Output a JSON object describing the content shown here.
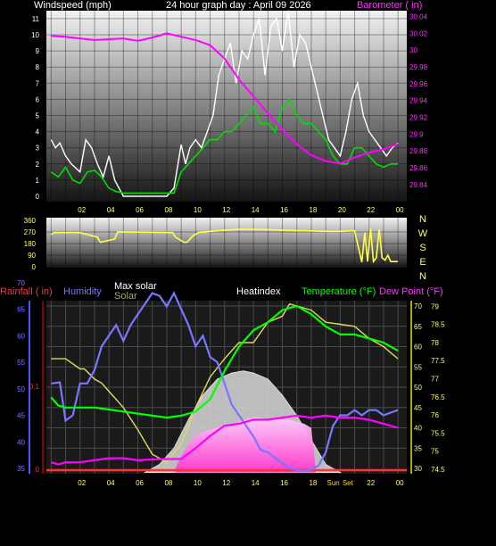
{
  "title": "24 hour graph day : April 09 2026",
  "colors": {
    "wind": "#ffffff",
    "gust": "#00dd00",
    "baro": "#ff00ff",
    "dir": "#ffff44",
    "rain": "#ff3333",
    "humidity": "#7777ff",
    "solar": "#dddddd",
    "solar_fill": "#ff66ff",
    "temp": "#00ff00",
    "dew": "#ff00ff",
    "heatindex": "#dddd55",
    "yaxis": "#ffff66"
  },
  "chart_data": [
    {
      "type": "line",
      "ylabel": "Windspeed (mph)",
      "y2label": "Barometer ( in)",
      "x_ticks": [
        "02",
        "04",
        "06",
        "08",
        "10",
        "12",
        "14",
        "16",
        "18",
        "20",
        "22",
        "00"
      ],
      "y_ticks": [
        "0",
        "1",
        "2",
        "3",
        "4",
        "5",
        "6",
        "7",
        "8",
        "9",
        "10",
        "11"
      ],
      "y2_ticks": [
        "29.84",
        "29.86",
        "29.88",
        "29.9",
        "29.92",
        "29.94",
        "29.96",
        "29.98",
        "30",
        "30.02",
        "30.04"
      ],
      "ylim": [
        0,
        11.7
      ],
      "y2lim": [
        29.826,
        30.047
      ],
      "series": [
        {
          "key": "wind_max",
          "hours": [
            0,
            0.3,
            0.6,
            1,
            1.4,
            2,
            2.4,
            2.8,
            3.2,
            3.6,
            4,
            4.4,
            5,
            5.5,
            6,
            6.5,
            7,
            7.5,
            8,
            8.5,
            9,
            9.3,
            9.6,
            10,
            10.4,
            10.8,
            11.2,
            11.6,
            12,
            12.4,
            12.8,
            13.2,
            13.6,
            14,
            14.4,
            14.8,
            15.2,
            15.6,
            16,
            16.4,
            16.8,
            17.2,
            17.6,
            18,
            18.4,
            18.8,
            19.2,
            19.6,
            20,
            20.4,
            20.8,
            21.2,
            21.6,
            22,
            22.4,
            22.8,
            23.2,
            23.6,
            24
          ],
          "values": [
            3.5,
            3,
            3.3,
            2.5,
            2,
            1.5,
            3.5,
            3,
            2,
            1.2,
            2.5,
            1,
            0,
            0,
            0,
            0,
            0,
            0,
            0,
            0.5,
            3.2,
            2,
            3,
            3.5,
            3,
            4,
            5,
            7.5,
            8.5,
            9.5,
            7,
            9,
            8.5,
            10,
            11,
            7.5,
            10.5,
            11,
            9,
            11.5,
            8,
            10,
            9.5,
            8,
            6.5,
            5,
            3.5,
            3,
            2.5,
            4,
            6,
            7,
            5,
            4,
            3.5,
            3,
            2.5,
            3,
            3.3
          ]
        },
        {
          "key": "wind_avg",
          "hours": [
            0,
            0.5,
            1,
            1.5,
            2,
            2.5,
            3,
            3.5,
            4,
            4.5,
            5,
            5.5,
            6,
            6.5,
            7,
            7.5,
            8,
            8.5,
            9,
            9.5,
            10,
            10.5,
            11,
            11.5,
            12,
            12.5,
            13,
            13.5,
            14,
            14.5,
            15,
            15.5,
            16,
            16.5,
            17,
            17.5,
            18,
            18.5,
            19,
            19.5,
            20,
            20.5,
            21,
            21.5,
            22,
            22.5,
            23,
            23.5,
            24
          ],
          "values": [
            1.5,
            1.2,
            1.8,
            1,
            0.8,
            1.5,
            1.6,
            1.2,
            0.5,
            0.3,
            0.2,
            0.2,
            0.2,
            0.2,
            0.2,
            0.2,
            0.2,
            0.2,
            1.5,
            2,
            2.5,
            3,
            3.5,
            3.5,
            4,
            4,
            4.5,
            5,
            5.5,
            4.5,
            4.5,
            4,
            5.5,
            6,
            5,
            4.5,
            4.5,
            4,
            3.5,
            2.5,
            2,
            2,
            3,
            3,
            2.5,
            2,
            1.8,
            2,
            2
          ]
        },
        {
          "key": "barometer",
          "hours": [
            0,
            1,
            2,
            3,
            4,
            5,
            6,
            7,
            8,
            9,
            10,
            11,
            12,
            13,
            14,
            15,
            16,
            17,
            18,
            19,
            20,
            21,
            22,
            23,
            24
          ],
          "values": [
            30.017,
            30.016,
            30.014,
            30.012,
            30.013,
            30.014,
            30.011,
            30.015,
            30.02,
            30.016,
            30.012,
            30.006,
            29.99,
            29.965,
            29.945,
            29.925,
            29.905,
            29.888,
            29.875,
            29.868,
            29.865,
            29.872,
            29.878,
            29.882,
            29.888
          ]
        }
      ]
    },
    {
      "type": "line",
      "ylabel": "Wind direction (deg)",
      "y_ticks": [
        "0",
        "90",
        "180",
        "270",
        "360"
      ],
      "compass": [
        "N",
        "W",
        "S",
        "E",
        "N"
      ],
      "ylim": [
        0,
        360
      ],
      "series": [
        {
          "key": "direction",
          "hours": [
            0,
            0.2,
            2,
            3.2,
            3.4,
            4.4,
            4.6,
            8.4,
            8.6,
            9.2,
            9.4,
            9.8,
            10.2,
            11,
            12,
            13,
            14,
            15,
            16,
            17,
            18,
            19,
            20,
            21,
            21.5,
            21.7,
            21.9,
            22.1,
            22.3,
            22.5,
            22.7,
            22.9,
            23.1,
            23.3,
            23.5,
            23.8,
            24
          ],
          "values": [
            250,
            265,
            265,
            230,
            190,
            215,
            270,
            265,
            230,
            190,
            190,
            240,
            265,
            275,
            283,
            290,
            290,
            288,
            283,
            280,
            278,
            275,
            275,
            280,
            35,
            265,
            40,
            300,
            40,
            70,
            290,
            70,
            50,
            90,
            40,
            40,
            40
          ]
        }
      ]
    },
    {
      "type": "line",
      "legend": [
        "Rainfall ( in)",
        "Humidity",
        "Max solar",
        "Solar",
        "Heatindex",
        "Temperature (°F)",
        "Dew Point (°F)"
      ],
      "x_ticks": [
        "02",
        "04",
        "06",
        "08",
        "10",
        "12",
        "14",
        "16",
        "18",
        "Sun",
        "Set",
        "22",
        "00"
      ],
      "humidity_ticks": [
        "35",
        "40",
        "45",
        "50",
        "55",
        "60",
        "65",
        "70"
      ],
      "rain_ticks": [
        "0",
        "0.1"
      ],
      "temp_ticks": [
        "30",
        "35",
        "40",
        "45",
        "50",
        "55",
        "60",
        "65",
        "70"
      ],
      "right_ticks": [
        "74.5",
        "75",
        "75.5",
        "76",
        "76.5",
        "77",
        "77.5",
        "78",
        "78.5",
        "79"
      ],
      "humidity_lim": [
        32,
        71.2
      ],
      "temp_lim": [
        28.9,
        71.8
      ],
      "series": [
        {
          "key": "humidity",
          "hours": [
            0,
            0.6,
            1,
            1.5,
            2,
            2.5,
            3,
            3.5,
            4,
            4.5,
            5,
            5.5,
            6,
            6.5,
            7,
            7.5,
            8,
            8.5,
            9,
            9.5,
            10,
            10.5,
            11,
            11.5,
            12,
            12.5,
            13,
            13.5,
            14,
            14.5,
            15,
            15.5,
            16,
            16.5,
            17,
            17.5,
            18,
            18.5,
            19,
            19.5,
            20,
            20.5,
            21,
            21.5,
            22,
            22.5,
            23,
            23.5,
            24
          ],
          "values": [
            51,
            51.2,
            44,
            45,
            51,
            51,
            53.5,
            58,
            60,
            62,
            59,
            62,
            64,
            66,
            68,
            67.5,
            65.5,
            68,
            65,
            62,
            58,
            60,
            56,
            55,
            51,
            47,
            45,
            43,
            41,
            38.5,
            38,
            37,
            36,
            35,
            34.7,
            34.5,
            34.8,
            35.5,
            38,
            43,
            45,
            45,
            46,
            45,
            46,
            46,
            45,
            45.5,
            46
          ]
        },
        {
          "key": "temperature",
          "hours": [
            0,
            0.5,
            1,
            2,
            3,
            4,
            5,
            6,
            7,
            8,
            9,
            10,
            11,
            12,
            13,
            14,
            15,
            16,
            17,
            18,
            19,
            20,
            21,
            22,
            23,
            24
          ],
          "values": [
            47.5,
            45.5,
            45,
            45,
            45,
            44.5,
            44,
            43.5,
            43,
            42.5,
            43,
            44,
            47,
            54,
            60,
            64,
            66,
            69,
            70,
            68,
            65,
            63,
            63,
            62,
            61,
            59
          ]
        },
        {
          "key": "heatindex",
          "hours": [
            0,
            1,
            2,
            2.3,
            3,
            3.5,
            4,
            5,
            6,
            7,
            8,
            9,
            10,
            11,
            12,
            13,
            14,
            15,
            16,
            16.5,
            17,
            18,
            19,
            20,
            21,
            22,
            23,
            24
          ],
          "values": [
            57,
            57,
            54.5,
            54.5,
            52,
            51,
            49,
            45,
            39.5,
            33.5,
            31.5,
            36,
            45,
            52.5,
            57,
            61,
            61,
            66,
            67.5,
            70.5,
            70,
            69,
            66,
            65.5,
            65,
            62,
            60,
            57
          ]
        },
        {
          "key": "dewpoint",
          "hours": [
            0,
            0.5,
            1,
            2,
            3,
            4,
            5,
            6,
            7,
            8,
            9,
            10,
            11,
            12,
            13,
            14,
            15,
            16,
            17,
            18,
            19,
            20,
            21,
            22,
            23,
            24
          ],
          "values": [
            31.5,
            31,
            31.5,
            31.5,
            32,
            32.5,
            32.5,
            32,
            32.2,
            32.3,
            32.3,
            35,
            38,
            40.5,
            41,
            42,
            42,
            42.5,
            43,
            42.5,
            43,
            42.5,
            42.5,
            42,
            41,
            40
          ]
        },
        {
          "key": "solar",
          "hours": [
            8.6,
            9,
            9.5,
            10,
            10.5,
            11,
            11.5,
            12,
            12.5,
            13,
            13.5,
            14,
            14.5,
            15,
            15.5,
            16,
            16.5,
            17,
            17.5,
            18,
            18.3
          ],
          "values": [
            30,
            33,
            36,
            38,
            39,
            39.5,
            40,
            40.5,
            41,
            41.5,
            42,
            42.5,
            42.5,
            42,
            42,
            42,
            42,
            41.5,
            41,
            40,
            30
          ]
        },
        {
          "key": "max_solar",
          "hours": [
            6.5,
            7.5,
            8.5,
            9.5,
            10.5,
            11.5,
            12.5,
            13.3,
            14,
            15,
            16,
            17,
            18,
            19,
            20
          ],
          "values": [
            29,
            31,
            35,
            42,
            48,
            52,
            53.5,
            54,
            53.5,
            52,
            48,
            43,
            37,
            31,
            29
          ]
        }
      ]
    }
  ]
}
